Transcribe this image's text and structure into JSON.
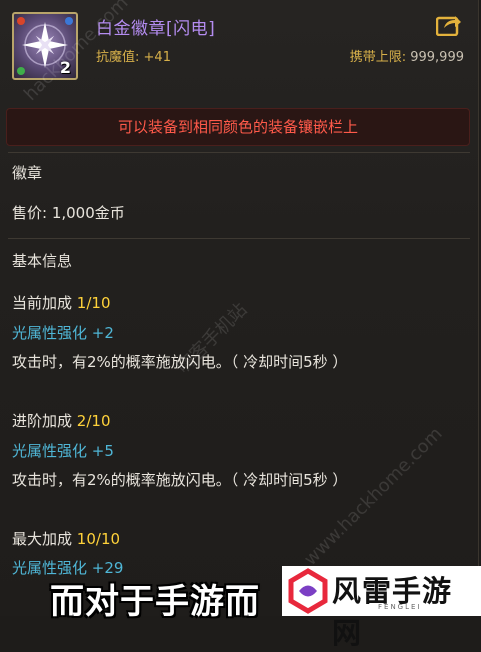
{
  "item": {
    "name": "白金徽章[闪电]",
    "count": "2",
    "stat_label": "抗魔值:",
    "stat_value": "+41",
    "carry_limit_label": "携带上限:",
    "carry_limit_value": "999,999"
  },
  "notice": "可以装备到相同颜色的装备镶嵌栏上",
  "category": "徽章",
  "price": "售价: 1,000金币",
  "section_title": "基本信息",
  "levels": [
    {
      "label": "当前加成",
      "value": "1/10",
      "attr": "光属性强化 +2",
      "effect": "攻击时，有2%的概率施放闪电。（ 冷却时间5秒 ）"
    },
    {
      "label": "进阶加成",
      "value": "2/10",
      "attr": "光属性强化 +5",
      "effect": "攻击时，有2%的概率施放闪电。（ 冷却时间5秒 ）"
    },
    {
      "label": "最大加成",
      "value": "10/10",
      "attr": "光属性强化 +29"
    }
  ],
  "caption": "而对于手游而",
  "logo": {
    "name": "风雷手游网",
    "sub": "FENGLEI"
  },
  "watermarks": [
    "hackhome.com",
    "嗨客手机站",
    "www.hackhome.com"
  ],
  "colors": {
    "title": "#b48cf0",
    "gold": "#ffd23a",
    "cyan": "#4fb6d6",
    "notice": "#ff5a4a"
  }
}
